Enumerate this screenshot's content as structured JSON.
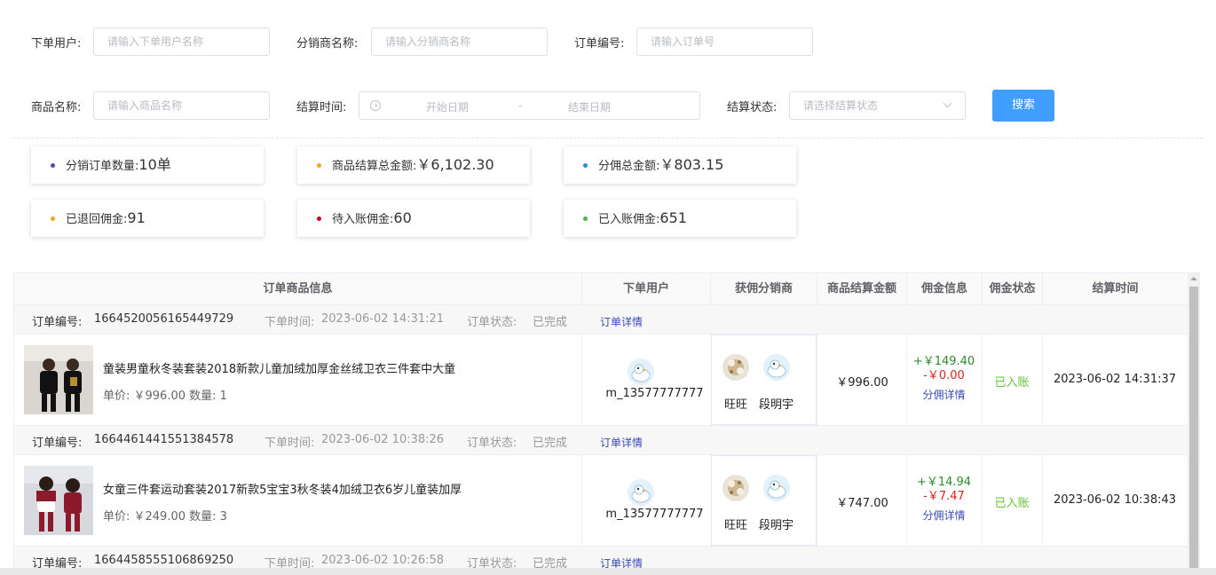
{
  "filters": {
    "user_label": "下单用户:",
    "user_placeholder": "请输入下单用户名称",
    "distributor_label": "分销商名称:",
    "distributor_placeholder": "请输入分销商名称",
    "order_no_label": "订单编号:",
    "order_no_placeholder": "请输入订单号",
    "product_label": "商品名称:",
    "product_placeholder": "请输入商品名称",
    "settle_time_label": "结算时间:",
    "start_date_placeholder": "开始日期",
    "date_separator": "-",
    "end_date_placeholder": "结束日期",
    "settle_status_label": "结算状态:",
    "settle_status_placeholder": "请选择结算状态",
    "search_button": "搜索"
  },
  "stats": [
    {
      "label": "分销订单数量:",
      "value": "10单",
      "color": "#5b4aaf"
    },
    {
      "label": "商品结算总金额:",
      "value": "￥6,102.30",
      "color": "#f5a623"
    },
    {
      "label": "分佣总金额:",
      "value": "￥803.15",
      "color": "#1e90d6"
    },
    {
      "label": "已退回佣金:",
      "value": "91",
      "color": "#f5a623"
    },
    {
      "label": "待入账佣金:",
      "value": "60",
      "color": "#d0021b"
    },
    {
      "label": "已入账佣金:",
      "value": "651",
      "color": "#4caf50"
    }
  ],
  "table": {
    "headers": [
      "订单商品信息",
      "下单用户",
      "获佣分销商",
      "商品结算金额",
      "佣金信息",
      "佣金状态",
      "结算时间"
    ],
    "orders": [
      {
        "order_no_label": "订单编号:",
        "order_no": "1664520056165449729",
        "order_time_label": "下单时间:",
        "order_time": "2023-06-02 14:31:21",
        "order_status_label": "订单状态:",
        "order_status": "已完成",
        "detail_link": "订单详情",
        "product_title": "童装男童秋冬装套装2018新款儿童加绒加厚金丝绒卫衣三件套中大童",
        "product_price": "单价: ￥996.00 数量: 1",
        "user_name": "m_13577777777",
        "distributors": [
          "旺旺",
          "段明宇"
        ],
        "amount": "￥996.00",
        "commission_in": "+￥149.40",
        "commission_out": "-￥0.00",
        "commission_link": "分佣详情",
        "status": "已入账",
        "settle_time": "2023-06-02 14:31:37"
      },
      {
        "order_no_label": "订单编号:",
        "order_no": "1664461441551384578",
        "order_time_label": "下单时间:",
        "order_time": "2023-06-02 10:38:26",
        "order_status_label": "订单状态:",
        "order_status": "已完成",
        "detail_link": "订单详情",
        "product_title": "女童三件套运动套装2017新款5宝宝3秋冬装4加绒卫衣6岁儿童装加厚",
        "product_price": "单价: ￥249.00 数量: 3",
        "user_name": "m_13577777777",
        "distributors": [
          "旺旺",
          "段明宇"
        ],
        "amount": "￥747.00",
        "commission_in": "+￥14.94",
        "commission_out": "-￥7.47",
        "commission_link": "分佣详情",
        "status": "已入账",
        "settle_time": "2023-06-02 10:38:43"
      },
      {
        "order_no_label": "订单编号:",
        "order_no": "1664458555106869250",
        "order_time_label": "下单时间:",
        "order_time": "2023-06-02 10:26:58",
        "order_status_label": "订单状态:",
        "order_status": "已完成",
        "detail_link": "订单详情"
      }
    ]
  }
}
